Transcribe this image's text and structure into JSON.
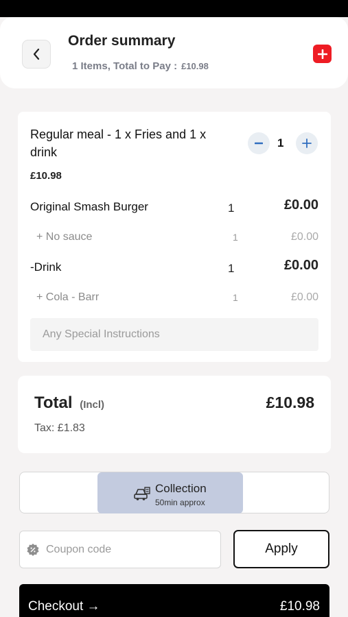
{
  "header": {
    "title": "Order summary",
    "subtitle": "1 Items, Total to Pay :",
    "subtitle_amount": "£10.98"
  },
  "item": {
    "title": "Regular meal - 1 x Fries and 1 x drink",
    "price": "£10.98",
    "quantity": "1",
    "minus_symbol": "-",
    "plus_symbol": "+",
    "lines": [
      {
        "name": "Original Smash Burger",
        "qty": "1",
        "price": "£0.00"
      },
      {
        "name": "+ No sauce",
        "qty": "1",
        "price": "£0.00"
      },
      {
        "name": "-Drink",
        "qty": "1",
        "price": "£0.00"
      },
      {
        "name": "+ Cola - Barr",
        "qty": "1",
        "price": "£0.00"
      }
    ],
    "instructions_placeholder": "Any Special Instructions"
  },
  "totals": {
    "label": "Total",
    "incl": "(Incl)",
    "amount": "£10.98",
    "tax": "Tax: £1.83"
  },
  "delivery": {
    "option": "Collection",
    "eta": "50min approx",
    "icon": "car-icon"
  },
  "coupon": {
    "placeholder": "Coupon code",
    "icon": "discount-badge-icon",
    "apply_label": "Apply"
  },
  "checkout": {
    "label": "Checkout →",
    "amount": "£10.98"
  },
  "colors": {
    "accent_red": "#ee1c24",
    "collection_bg": "#c3cbdf",
    "checkout_bg": "#000000",
    "qty_btn_bg": "#e9eef3",
    "qty_icon": "#2f6dbf"
  }
}
